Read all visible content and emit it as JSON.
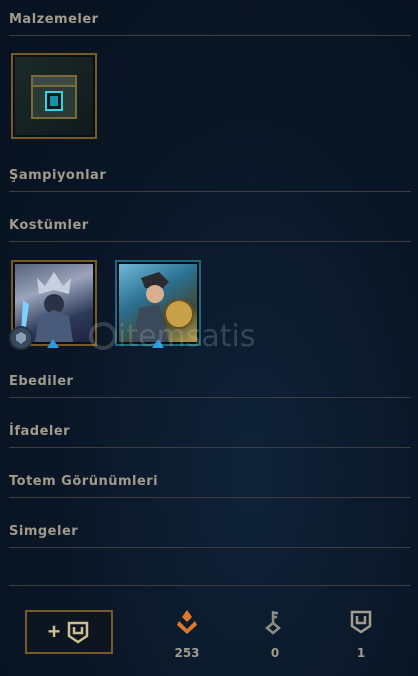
{
  "sections": {
    "materials": "Malzemeler",
    "champions": "Şampiyonlar",
    "skins": "Kostümler",
    "eternals": "Ebediler",
    "emotes": "İfadeler",
    "ward_skins": "Totem Görünümleri",
    "icons": "Simgeler"
  },
  "watermark": "itemsatis",
  "currencies": [
    {
      "name": "orange-essence",
      "value": "253",
      "color": "#e0782a"
    },
    {
      "name": "key-fragment",
      "value": "0",
      "color": "#8f8c86"
    },
    {
      "name": "chest",
      "value": "1",
      "color": "#a09b8c"
    }
  ],
  "icons": [
    "chest-icon",
    "champion-mastery-icon",
    "upgrade-triangle-icon",
    "orange-essence-icon",
    "key-icon"
  ],
  "colors": {
    "gold_border": "#785a28",
    "text": "#a09b8c",
    "blue_accent": "#2a9de0"
  }
}
